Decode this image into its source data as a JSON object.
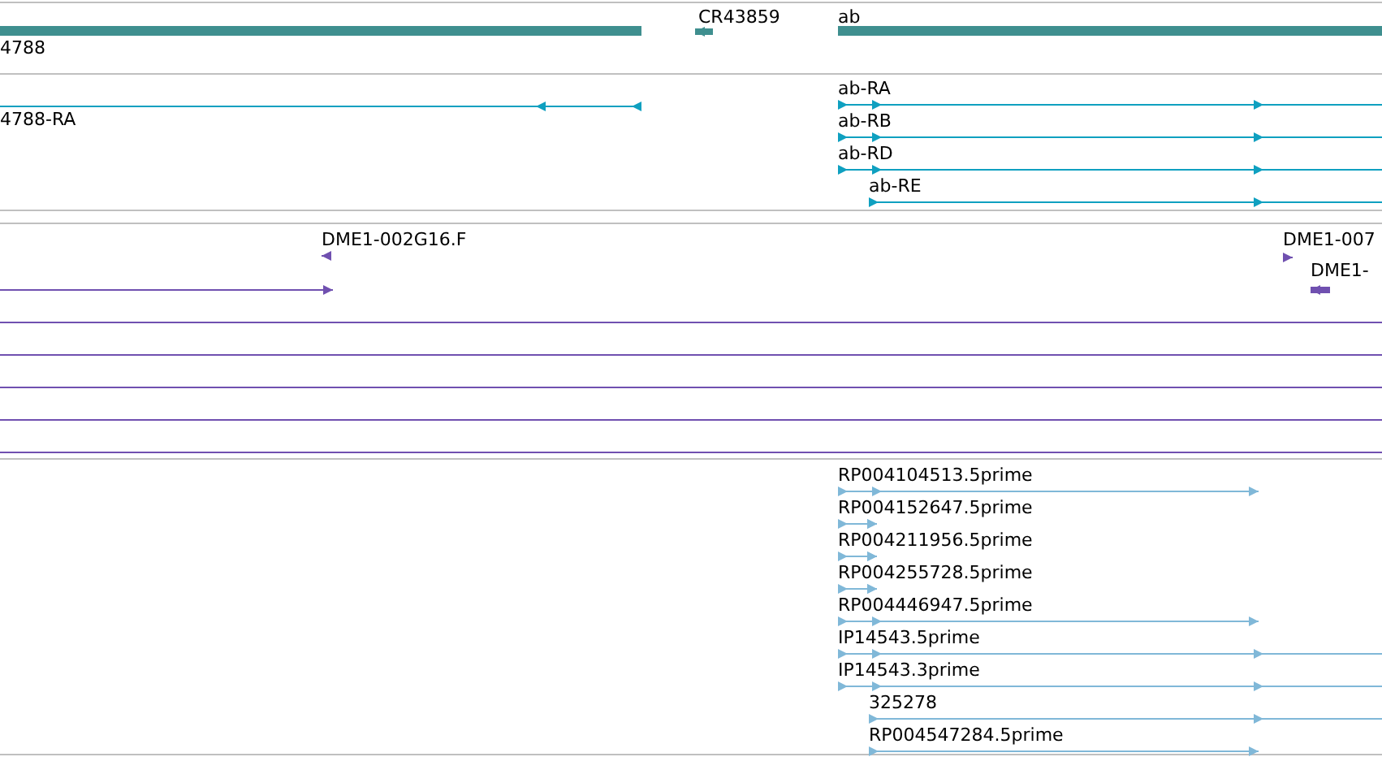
{
  "tracks": [
    {
      "kind": "genes",
      "features": [
        {
          "label": "4788"
        },
        {
          "label": "CR43859"
        },
        {
          "label": "ab"
        }
      ]
    },
    {
      "kind": "transcripts",
      "features": [
        {
          "label": "4788-RA"
        },
        {
          "label": "ab-RA"
        },
        {
          "label": "ab-RB"
        },
        {
          "label": "ab-RD"
        },
        {
          "label": "ab-RE"
        }
      ]
    },
    {
      "kind": "clones",
      "features": [
        {
          "label": "DME1-002G16.F"
        },
        {
          "label": "DME1-007"
        },
        {
          "label": "DME1-"
        }
      ]
    },
    {
      "kind": "ests",
      "features": [
        {
          "label": "RP004104513.5prime"
        },
        {
          "label": "RP004152647.5prime"
        },
        {
          "label": "RP004211956.5prime"
        },
        {
          "label": "RP004255728.5prime"
        },
        {
          "label": "RP004446947.5prime"
        },
        {
          "label": "IP14543.5prime"
        },
        {
          "label": "IP14543.3prime"
        },
        {
          "label": "325278"
        },
        {
          "label": "RP004547284.5prime"
        }
      ]
    }
  ]
}
